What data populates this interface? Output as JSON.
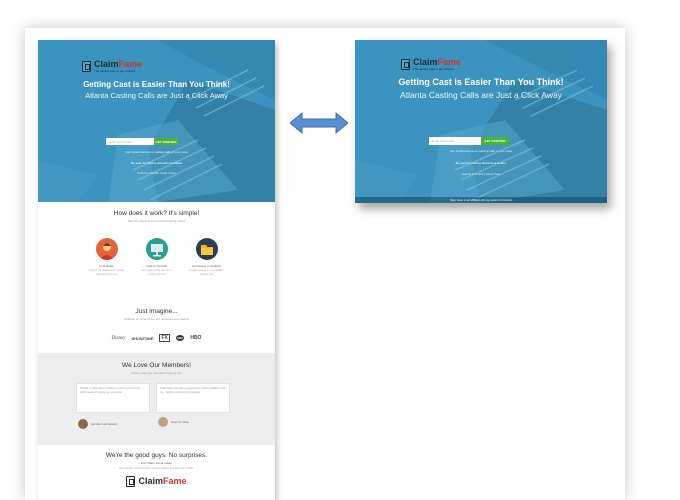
{
  "logo": {
    "name_part1": "Claim",
    "name_part2": "Fame",
    "tagline": "The easiest way to get noticed"
  },
  "hero": {
    "title": "Getting Cast is Easier Than You Think!",
    "subtitle": "Atlanta Casting Calls are Just a Click Away",
    "email_placeholder": "Enter your email",
    "cta_label": "GET STARTED",
    "line1": "Get instant access to casting calls in your area",
    "line2": "Be seen by casting directors & studios",
    "line3": "Submit it Simple | Fast | Free",
    "footer": "Claim Fame is not affiliated with any studio or production"
  },
  "how": {
    "title": "How does it work? It's simple!",
    "subtitle": "Take the steps to a successful acting career",
    "steps": [
      {
        "label": "Find Roles",
        "text": "Search our database of casting calls tailored to you"
      },
      {
        "label": "Submit Yourself",
        "text": "Send your profile directly to casting directors"
      },
      {
        "label": "Get Ready to Audition",
        "text": "Prepare and go to your audition and get cast"
      }
    ]
  },
  "imagine": {
    "title": "Just Imagine...",
    "subtitle": "Working on projects for top networks and studios",
    "brands": [
      "Disney",
      "SHOWTIME",
      "FX",
      "ABC",
      "HBO"
    ]
  },
  "love": {
    "title": "We Love Our Members!",
    "subtitle": "Here's what our members have to say",
    "quotes": [
      "Thanks to Claim Fame I landed a role in a commercial within weeks of signing up. Great site!",
      "Claim Fame has been a great help in finding auditions near me. I highly recommend it to anyone."
    ],
    "members": [
      "Jennifer Hernandez",
      "Kevin D. Rae"
    ]
  },
  "good": {
    "title": "We're the good guys. No surprises.",
    "subtitle": "Join Claim Fame today!",
    "text": "No contracts, no hidden fees. Cancel anytime and keep your profile."
  },
  "colors": {
    "hero_blue": "#3c93bd",
    "cta_green": "#4ab33a",
    "brand_red": "#c53a2a",
    "arrow_blue": "#5b8fd0"
  }
}
